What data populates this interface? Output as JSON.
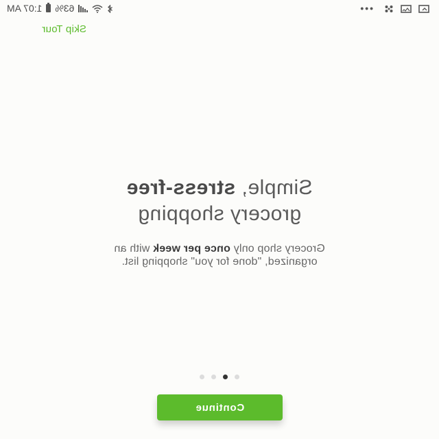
{
  "status_bar": {
    "time": "1:07 AM",
    "battery_percent": "63%",
    "icons_left": [
      "screenshot-thumbnail-icon",
      "gallery-icon",
      "fan-icon",
      "overflow-dots-icon"
    ],
    "icons_right": [
      "bluetooth-icon",
      "wifi-icon",
      "signal-icon",
      "battery-icon"
    ]
  },
  "header": {
    "skip_label": "Skip Tour"
  },
  "slide": {
    "headline_pre": "Simple, ",
    "headline_bold": "stress-free",
    "headline_line2": "grocery shopping",
    "body_pre": "Grocery shop only ",
    "body_bold": "once per week",
    "body_post": " with an organized, \"done for you\" shopping list."
  },
  "pager": {
    "total": 4,
    "active_index": 1
  },
  "footer": {
    "continue_label": "Continue"
  },
  "colors": {
    "accent": "#5cbb2c",
    "background": "#fcfcfa",
    "text": "#5a5a5a"
  }
}
